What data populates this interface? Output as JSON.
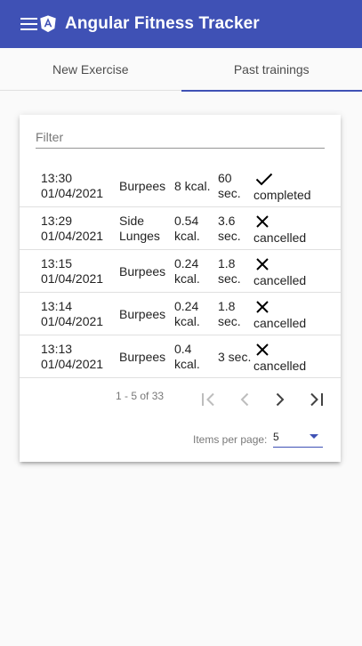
{
  "header": {
    "title": "Angular Fitness Tracker",
    "menu_icon": "menu-icon",
    "logo_icon": "angular-logo-icon"
  },
  "tabs": [
    {
      "label": "New Exercise",
      "active": false
    },
    {
      "label": "Past trainings",
      "active": true
    }
  ],
  "filter": {
    "placeholder": "Filter",
    "value": ""
  },
  "rows": [
    {
      "time": "13:30",
      "date": "01/04/2021",
      "name": "Burpees",
      "calories": "8 kcal.",
      "duration": "60 sec.",
      "state_icon": "check-icon",
      "state": "completed"
    },
    {
      "time": "13:29",
      "date": "01/04/2021",
      "name": "Side Lunges",
      "calories": "0.54 kcal.",
      "duration": "3.6 sec.",
      "state_icon": "close-icon",
      "state": "cancelled"
    },
    {
      "time": "13:15",
      "date": "01/04/2021",
      "name": "Burpees",
      "calories": "0.24 kcal.",
      "duration": "1.8 sec.",
      "state_icon": "close-icon",
      "state": "cancelled"
    },
    {
      "time": "13:14",
      "date": "01/04/2021",
      "name": "Burpees",
      "calories": "0.24 kcal.",
      "duration": "1.8 sec.",
      "state_icon": "close-icon",
      "state": "cancelled"
    },
    {
      "time": "13:13",
      "date": "01/04/2021",
      "name": "Burpees",
      "calories": "0.4 kcal.",
      "duration": "3 sec.",
      "state_icon": "close-icon",
      "state": "cancelled"
    }
  ],
  "paginator": {
    "range": "1 - 5 of 33",
    "items_per_page_label": "Items per page:",
    "items_per_page_value": "5"
  },
  "colors": {
    "primary": "#3f51b5",
    "background": "#fafafa"
  }
}
